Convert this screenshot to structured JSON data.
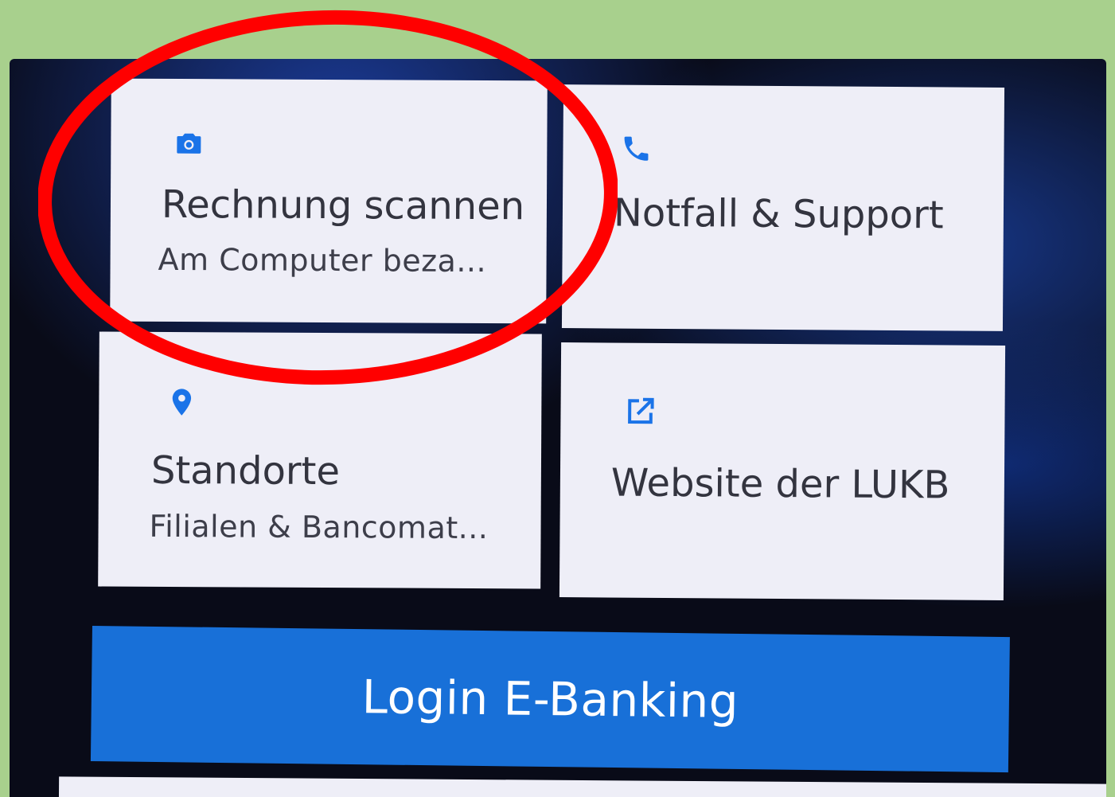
{
  "tiles": [
    {
      "id": "rechnung",
      "icon": "camera-icon",
      "title": "Rechnung scannen",
      "subtitle": "Am Computer beza..."
    },
    {
      "id": "notfall",
      "icon": "phone-icon",
      "title": "Notfall & Support",
      "subtitle": ""
    },
    {
      "id": "standorte",
      "icon": "location-pin-icon",
      "title": "Standorte",
      "subtitle": "Filialen & Bancomat..."
    },
    {
      "id": "website",
      "icon": "external-link-icon",
      "title": "Website der LUKB",
      "subtitle": ""
    }
  ],
  "login_button": {
    "label": "Login E-Banking"
  },
  "colors": {
    "background_frame": "#a8d08d",
    "tile_background": "#eeeef7",
    "accent_blue": "#1870d8",
    "icon_blue": "#1a73e8",
    "highlight_ring": "#ff0000"
  }
}
